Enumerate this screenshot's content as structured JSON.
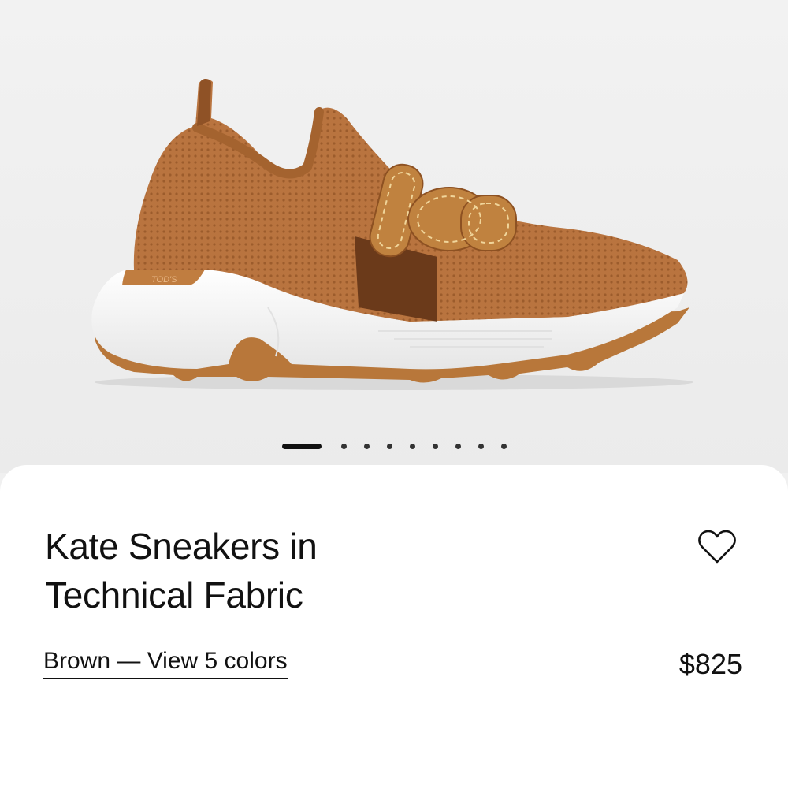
{
  "gallery": {
    "image_alt": "Kate Sneakers in Technical Fabric",
    "image_mark": "TOD'S",
    "slide_count": 9,
    "active_slide": 1
  },
  "product": {
    "title_line1": "Kate Sneakers in",
    "title_line2": "Technical Fabric",
    "color_link": "Brown — View 5 colors",
    "price": "$825"
  },
  "icons": {
    "wishlist": "heart-outline-icon"
  },
  "colors": {
    "upper": "#b8733e",
    "sole": "#ffffff",
    "gum": "#b8773a",
    "text": "#111111"
  }
}
